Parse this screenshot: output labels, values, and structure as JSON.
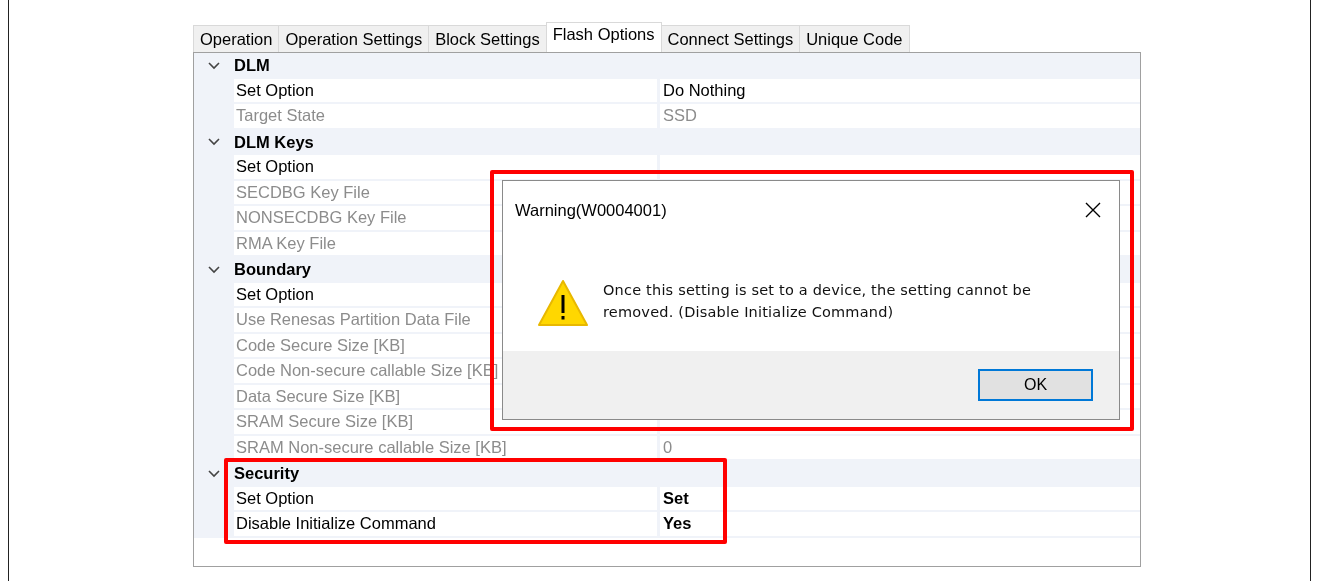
{
  "tabs": [
    {
      "label": "Operation",
      "selected": false
    },
    {
      "label": "Operation Settings",
      "selected": false
    },
    {
      "label": "Block Settings",
      "selected": false
    },
    {
      "label": "Flash Options",
      "selected": true
    },
    {
      "label": "Connect Settings",
      "selected": false
    },
    {
      "label": "Unique Code",
      "selected": false
    }
  ],
  "categories": [
    {
      "name": "DLM",
      "expanded": true,
      "highlighted": false,
      "rows": [
        {
          "name": "Set Option",
          "value": "Do Nothing",
          "disabled": false,
          "modified": false
        },
        {
          "name": "Target State",
          "value": "SSD",
          "disabled": true,
          "modified": false
        }
      ]
    },
    {
      "name": "DLM Keys",
      "expanded": true,
      "highlighted": false,
      "rows": [
        {
          "name": "Set Option",
          "disabled": false
        },
        {
          "name": "SECDBG Key File",
          "disabled": true
        },
        {
          "name": "NONSECDBG Key File",
          "disabled": true
        },
        {
          "name": "RMA Key File",
          "disabled": true
        }
      ]
    },
    {
      "name": "Boundary",
      "expanded": true,
      "highlighted": false,
      "rows": [
        {
          "name": "Set Option",
          "disabled": false
        },
        {
          "name": "Use Renesas Partition Data File",
          "disabled": true
        },
        {
          "name": "Code Secure Size [KB]",
          "disabled": true
        },
        {
          "name": "Code Non-secure callable Size [KB]",
          "disabled": true
        },
        {
          "name": "Data Secure Size [KB]",
          "disabled": true
        },
        {
          "name": "SRAM Secure Size [KB]",
          "disabled": true
        },
        {
          "name": "SRAM Non-secure callable Size [KB]",
          "value": "0",
          "disabled": true,
          "modified": false
        }
      ]
    },
    {
      "name": "Security",
      "expanded": true,
      "highlighted": true,
      "rows": [
        {
          "name": "Set Option",
          "value": "Set",
          "disabled": false,
          "modified": true
        },
        {
          "name": "Disable Initialize Command",
          "value": "Yes",
          "disabled": false,
          "modified": true
        }
      ]
    }
  ],
  "dialog": {
    "title": "Warning(W0004001)",
    "message": "Once this setting is set to a device, the setting cannot be removed. (Disable Initialize Command)",
    "button": "OK",
    "highlighted": true
  }
}
